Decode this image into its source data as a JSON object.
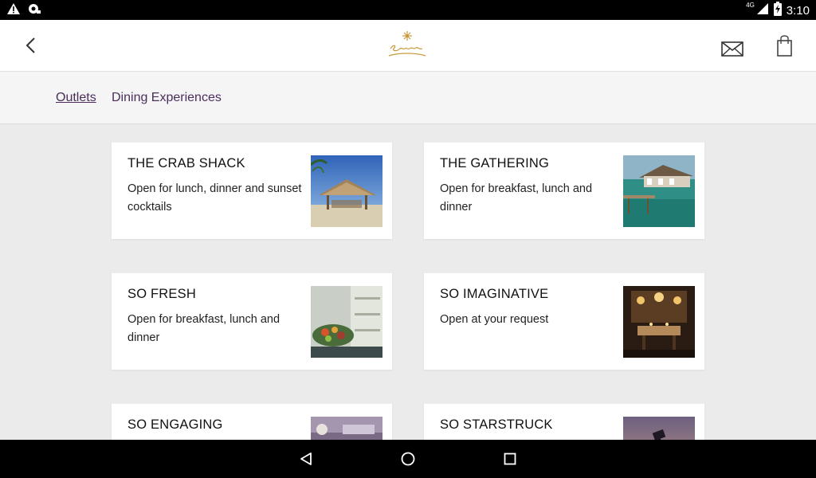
{
  "status_bar": {
    "time": "3:10",
    "network": "4G",
    "icons_left": [
      "warning-icon",
      "radio-icon"
    ],
    "icons_right": [
      "signal-icon",
      "battery-icon"
    ]
  },
  "app_bar": {
    "back_icon": "chevron-left-icon",
    "logo": "resort-logo",
    "mail_icon": "envelope-icon",
    "bag_icon": "shopping-bag-icon",
    "accent_color": "#c89a3c"
  },
  "tabs": [
    {
      "label": "Outlets",
      "active": true
    },
    {
      "label": "Dining Experiences",
      "active": false
    }
  ],
  "cards": [
    {
      "title": "THE CRAB SHACK",
      "description": "Open for lunch, dinner and sunset cocktails",
      "image": "beach-hut-photo"
    },
    {
      "title": "THE GATHERING",
      "description": "Open for breakfast, lunch and dinner",
      "image": "overwater-pavilion-photo"
    },
    {
      "title": "SO FRESH",
      "description": "Open for breakfast, lunch and dinner",
      "image": "fresh-produce-photo"
    },
    {
      "title": "SO IMAGINATIVE",
      "description": "Open at your request",
      "image": "candlelit-dinner-photo"
    },
    {
      "title": "SO ENGAGING",
      "description": "",
      "image": "cooking-class-photo"
    },
    {
      "title": "SO STARSTRUCK",
      "description": "",
      "image": "observatory-dusk-photo"
    }
  ],
  "nav_bar": {
    "buttons": [
      "nav-back-icon",
      "nav-home-icon",
      "nav-recents-icon"
    ]
  }
}
